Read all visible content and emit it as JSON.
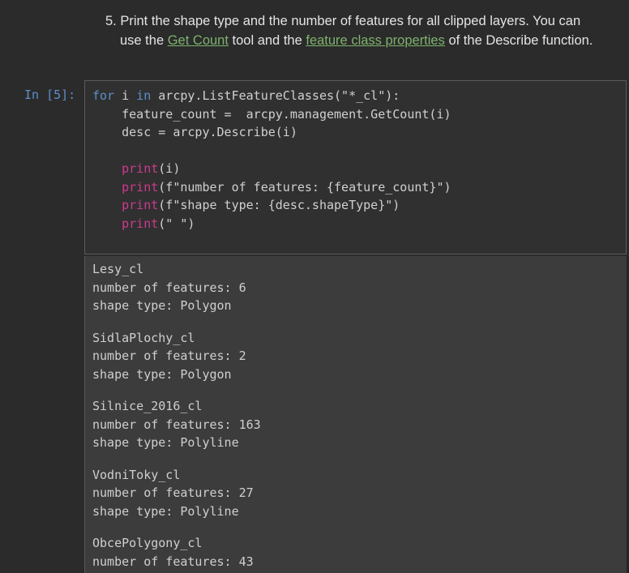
{
  "markdown": {
    "line1": "5. Print the shape type and the number of features for all clipped layers. You can",
    "line2_prefix": "use the ",
    "link1": "Get Count",
    "line2_middle": " tool and the ",
    "link2": "feature class properties",
    "line2_suffix": " of the Describe function."
  },
  "cell": {
    "prompt": "In [5]:",
    "code": {
      "l1_for": "for",
      "l1_mid": " i ",
      "l1_in": "in",
      "l1_rest": " arcpy.ListFeatureClasses(\"*_cl\"):",
      "l2": "    feature_count =  arcpy.management.GetCount(i)",
      "l3": "    desc = arcpy.Describe(i)",
      "l5_fn": "print",
      "l5_rest": "(i)",
      "l6_fn": "print",
      "l6_rest": "(f\"number of features: {feature_count}\")",
      "l7_fn": "print",
      "l7_rest": "(f\"shape type: {desc.shapeType}\")",
      "l8_fn": "print",
      "l8_rest": "(\" \")"
    }
  },
  "output": {
    "blocks": [
      {
        "name": "Lesy_cl",
        "count": "number of features: 6",
        "shape": "shape type: Polygon"
      },
      {
        "name": "SidlaPlochy_cl",
        "count": "number of features: 2",
        "shape": "shape type: Polygon"
      },
      {
        "name": "Silnice_2016_cl",
        "count": "number of features: 163",
        "shape": "shape type: Polyline"
      },
      {
        "name": "VodniToky_cl",
        "count": "number of features: 27",
        "shape": "shape type: Polyline"
      },
      {
        "name": "ObcePolygony_cl",
        "count": "number of features: 43",
        "shape": ""
      }
    ]
  }
}
